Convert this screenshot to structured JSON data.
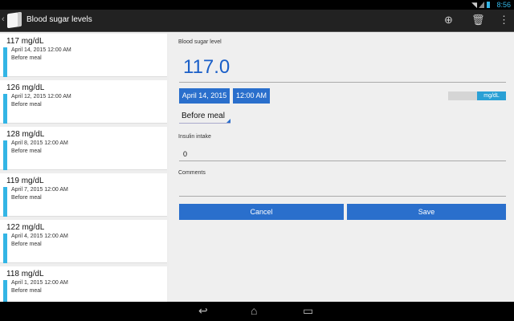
{
  "status": {
    "time": "8:56"
  },
  "actionbar": {
    "title": "Blood sugar levels",
    "add_icon": "add-circle-icon",
    "delete_icon": "trash-icon",
    "overflow_icon": "overflow-menu-icon"
  },
  "list": [
    {
      "value": "117 mg/dL",
      "datetime": "April 14, 2015  12:00 AM",
      "meal": "Before meal"
    },
    {
      "value": "126 mg/dL",
      "datetime": "April 12, 2015  12:00 AM",
      "meal": "Before meal"
    },
    {
      "value": "128 mg/dL",
      "datetime": "April 8, 2015  12:00 AM",
      "meal": "Before meal"
    },
    {
      "value": "119 mg/dL",
      "datetime": "April 7, 2015  12:00 AM",
      "meal": "Before meal"
    },
    {
      "value": "122 mg/dL",
      "datetime": "April 4, 2015  12:00 AM",
      "meal": "Before meal"
    },
    {
      "value": "118 mg/dL",
      "datetime": "April 1, 2015  12:00 AM",
      "meal": "Before meal"
    }
  ],
  "detail": {
    "level_label": "Blood sugar level",
    "level_value": "117.0",
    "date": "April 14, 2015",
    "time": "12:00 AM",
    "unit": "mg/dL",
    "meal": "Before meal",
    "insulin_label": "Insulin intake",
    "insulin_value": "0",
    "comments_label": "Comments",
    "comments_value": "",
    "cancel": "Cancel",
    "save": "Save"
  }
}
